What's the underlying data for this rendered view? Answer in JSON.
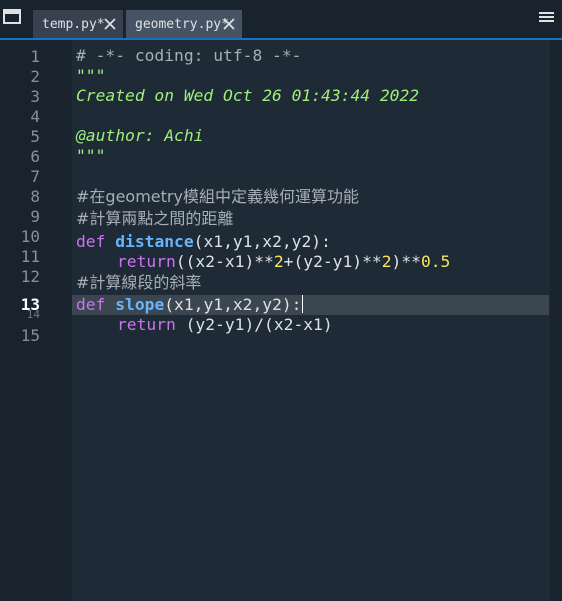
{
  "tabs": [
    {
      "label": "temp.py*"
    },
    {
      "label": "geometry.py*"
    }
  ],
  "gutter": {
    "numbers": [
      "1",
      "2",
      "3",
      "4",
      "5",
      "6",
      "7",
      "8",
      "9",
      "10",
      "11",
      "12",
      "13",
      "14",
      "15"
    ],
    "active": "13"
  },
  "code": {
    "l1": "# -*- coding: utf-8 -*-",
    "l2": "\"\"\"",
    "l3": "Created on Wed Oct 26 01:43:44 2022",
    "l5": "@author: Achi",
    "l6": "\"\"\"",
    "l8": "#在geometry模組中定義幾何運算功能",
    "l9": "#計算兩點之間的距離",
    "l10_kw": "def",
    "l10_fn": "distance",
    "l10_rest": "(x1,y1,x2,y2):",
    "l11_kw": "return",
    "l11_a": "((x2-x1)**",
    "l11_n1": "2",
    "l11_b": "+(y2-y1)**",
    "l11_n2": "2",
    "l11_c": ")**",
    "l11_n3": "0.5",
    "l12": "#計算線段的斜率",
    "l13_kw": "def",
    "l13_fn": "slope",
    "l13_rest": "(x1,y1,x2,y2):",
    "l14_kw": "return",
    "l14_rest": " (y2-y1)/(x2-x1)"
  },
  "colors": {
    "background": "#19232d",
    "accent": "#1a72bb",
    "keyword": "#cd72f2",
    "function": "#67b5fa",
    "number": "#f8e45c",
    "docstring": "#9ff07a"
  }
}
